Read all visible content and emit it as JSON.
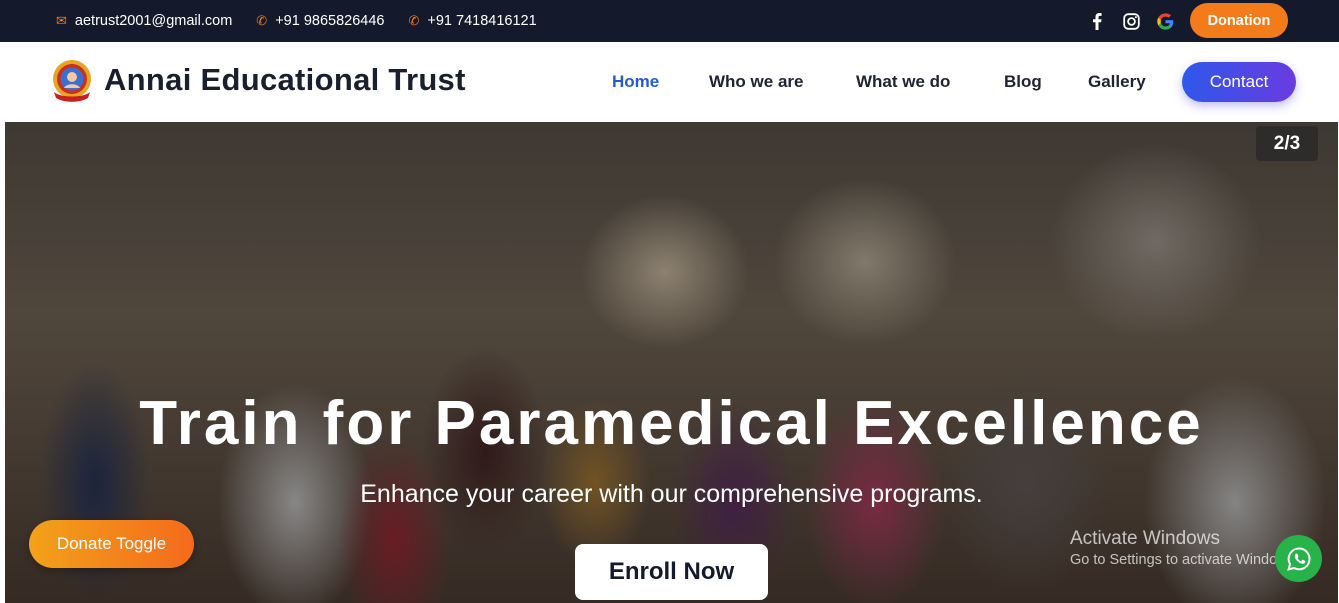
{
  "topbar": {
    "email": "aetrust2001@gmail.com",
    "phone1": "+91 9865826446",
    "phone2": "+91 7418416121",
    "icons": [
      "mail-icon",
      "phone-icon",
      "facebook-icon",
      "instagram-icon",
      "google-icon"
    ],
    "donation_label": "Donation"
  },
  "navbar": {
    "brand": "Annai Educational Trust",
    "links": [
      "Home",
      "Who we are",
      "What we do",
      "Blog",
      "Gallery"
    ],
    "active": "Home",
    "contact_label": "Contact"
  },
  "hero": {
    "counter": "2/3",
    "headline": "Train for Paramedical Excellence",
    "subline": "Enhance your career with our comprehensive programs.",
    "enroll_label": "Enroll Now",
    "donate_toggle_label": "Donate Toggle",
    "activate_title": "Activate Windows",
    "activate_subtitle": "Go to Settings to activate Windows."
  },
  "colors": {
    "topbar_bg": "#141a2c",
    "accent_orange": "#f47b1a",
    "nav_active": "#2459e0",
    "contact_gradient": [
      "#2f57ea",
      "#6a3be0"
    ],
    "whatsapp_green": "#27b24a"
  }
}
